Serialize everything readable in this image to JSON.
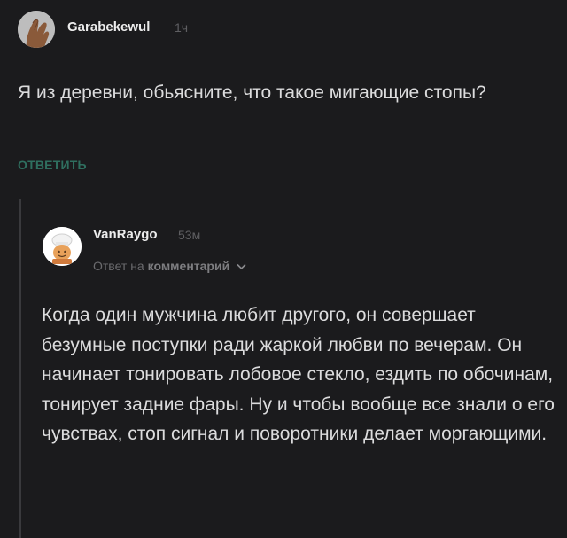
{
  "parent_comment": {
    "author": "Garabekewul",
    "time": "1ч",
    "text": "Я из деревни, обьясните, что такое мигающие стопы?",
    "reply_label": "ОТВЕТИТЬ"
  },
  "reply_comment": {
    "author": "VanRaygo",
    "time": "53м",
    "reply_prefix": "Ответ на",
    "reply_target": "комментарий",
    "text": "Когда один мужчина любит другого, он совершает безумные поступки ради жаркой любви по вечерам. Он начинает тонировать лобовое стекло, ездить по обочинам, тонирует задние фары. Ну и чтобы вообще все знали о его чувствах, стоп сигнал и поворотники делает моргающими."
  },
  "colors": {
    "background": "#1b1b1d",
    "reply_accent": "#2f6f5f",
    "muted": "#5f5f62"
  }
}
